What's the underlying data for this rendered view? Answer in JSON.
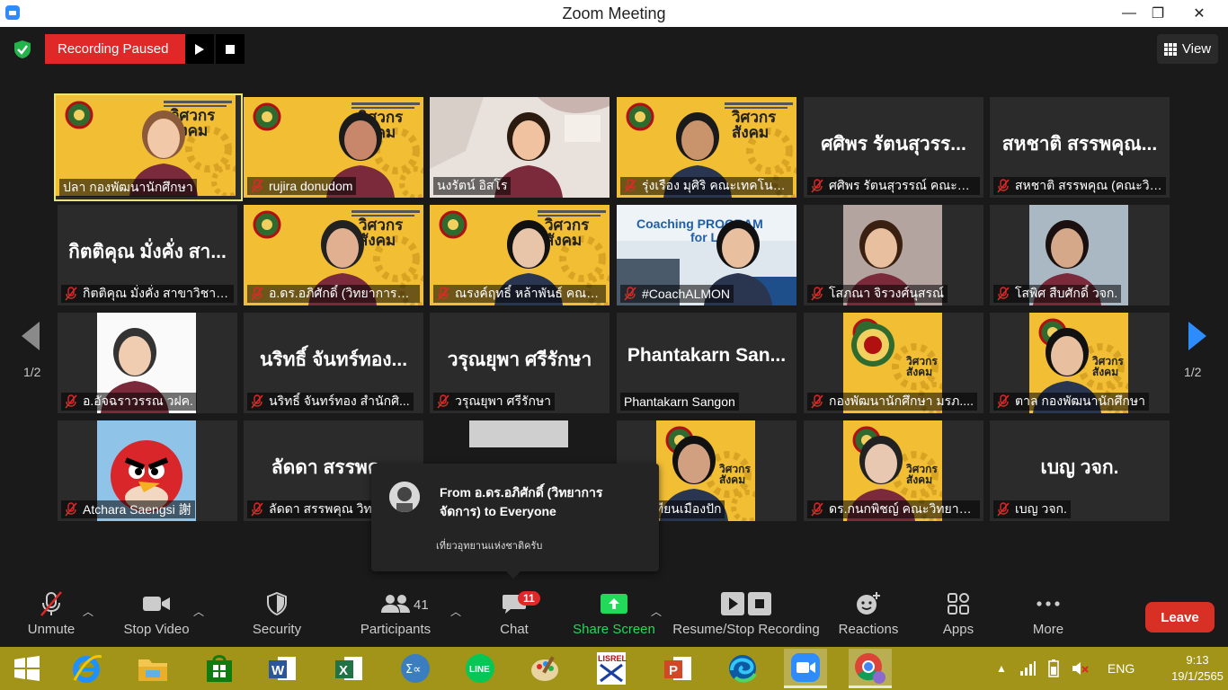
{
  "window": {
    "title": "Zoom Meeting",
    "minimize": "—",
    "maximize": "❐",
    "close": "✕"
  },
  "recording": {
    "status": "Recording Paused",
    "play_icon": "play-icon",
    "stop_icon": "stop-icon"
  },
  "view_button": "View",
  "pagination": {
    "left": "1/2",
    "right": "1/2"
  },
  "tiles": [
    {
      "label": "ปลา กองพัฒนานักศึกษา",
      "muted": false,
      "active": true,
      "big": ""
    },
    {
      "label": "rujira donudom",
      "muted": true,
      "big": ""
    },
    {
      "label": "นงรัตน์ อิสโร",
      "muted": false,
      "big": ""
    },
    {
      "label": "รุ่งเรือง มุศิริ คณะเทคโนโลย...",
      "muted": true,
      "big": ""
    },
    {
      "label": "ศศิพร รัตนสุวรรณ์ คณะวิท...",
      "muted": true,
      "big": "ศศิพร รัตนสุวรร..."
    },
    {
      "label": "สหชาติ สรรพคุณ (คณะวิท...",
      "muted": true,
      "big": "สหชาติ สรรพคุณ..."
    },
    {
      "label": "กิตติคุณ  มั่งคั่ง สาขาวิชาเ...",
      "muted": true,
      "big": "กิตติคุณ  มั่งคั่ง สา..."
    },
    {
      "label": "อ.ดร.อภิศักดิ์ (วิทยาการจัด...",
      "muted": true,
      "big": ""
    },
    {
      "label": "ณรงค์ฤทธิ์ หล้าพันธ์ คณะว...",
      "muted": true,
      "big": ""
    },
    {
      "label": "#CoachALMON",
      "muted": true,
      "big": ""
    },
    {
      "label": "โสภณา จิรวงศ์นุสรณ์",
      "muted": true,
      "big": ""
    },
    {
      "label": "โสพิศ สืบศักดิ์ วจก.",
      "muted": true,
      "big": ""
    },
    {
      "label": "อ.อัจฉราวรรณ วฝค.",
      "muted": true,
      "big": ""
    },
    {
      "label": "นริทธิ์ จันทร์ทอง สำนักศิ...",
      "muted": true,
      "big": "นริทธิ์ จันทร์ทอง..."
    },
    {
      "label": "วรุณยุพา ศรีรักษา",
      "muted": true,
      "big": "วรุณยุพา ศรีรักษา"
    },
    {
      "label": "Phantakarn Sangon",
      "muted": false,
      "big": "Phantakarn San..."
    },
    {
      "label": "กองพัฒนานักศึกษา มรภ....",
      "muted": true,
      "big": ""
    },
    {
      "label": "ตาล กองพัฒนานักศึกษา",
      "muted": true,
      "big": ""
    },
    {
      "label": "Atchara Saengsi 謝",
      "muted": true,
      "big": ""
    },
    {
      "label": "ลัดดา สรรพคุณ  วิท...",
      "muted": true,
      "big": "ลัดดา สรรพคุ..."
    },
    {
      "label": "",
      "muted": false,
      "big": ""
    },
    {
      "label": "รัตน์ เทียนเมืองปัก",
      "muted": false,
      "big": ""
    },
    {
      "label": "ดร.กนกพิชญ์ คณะวิทยาก...",
      "muted": true,
      "big": ""
    },
    {
      "label": "เบญ วจก.",
      "muted": true,
      "big": "เบญ วจก."
    }
  ],
  "tile_text": {
    "poster_line1": "วิศวกร",
    "poster_line2": "สังคม",
    "coach_banner": "Coaching PROGRAM",
    "coach_sub": "for Le"
  },
  "chat_popup": {
    "from": "From อ.ดร.อภิศักดิ์ (วิทยาการจัดการ) to Everyone",
    "message": "เที่ยวอุทยานแห่งชาติครับ"
  },
  "toolbar": {
    "unmute": "Unmute",
    "stop_video": "Stop Video",
    "security": "Security",
    "participants": "Participants",
    "participants_count": "41",
    "chat": "Chat",
    "chat_badge": "11",
    "share_screen": "Share Screen",
    "resume_stop": "Resume/Stop Recording",
    "reactions": "Reactions",
    "apps": "Apps",
    "more": "More",
    "leave": "Leave"
  },
  "taskbar": {
    "language": "ENG",
    "time": "9:13",
    "date": "19/1/2565",
    "lisrel": "LISREL"
  },
  "colors": {
    "recording_red": "#e02828",
    "share_green": "#23d959",
    "leave_red": "#d93025",
    "taskbar": "#a29418",
    "active_speaker": "#e5e57a",
    "page_arrow": "#2d8cff"
  }
}
